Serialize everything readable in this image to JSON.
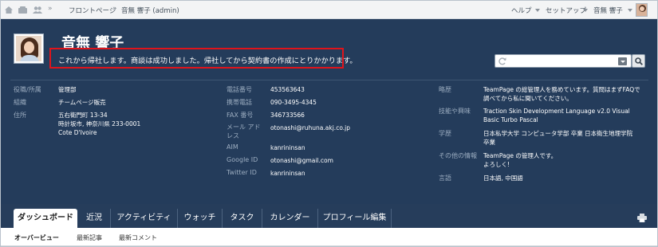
{
  "topbar": {
    "breadcrumb_home": "フロントページ",
    "breadcrumb_sep": "»",
    "breadcrumb_current": "音無 響子 (admin)",
    "help": "ヘルプ",
    "setup": "セットアップ",
    "user": "音無 響子"
  },
  "profile": {
    "name": "音無 響子",
    "status": "これから帰社します。商談は成功しました。帰社してから契約書の作成にとりかかります。"
  },
  "search": {
    "placeholder": ""
  },
  "fields_col1": [
    {
      "label": "役職/所属",
      "value": "管理部"
    },
    {
      "label": "組織",
      "value": "チームページ販売"
    },
    {
      "label": "住所",
      "value_lines": [
        "五右衛門町 13-34",
        "時計坂市, 神奈川県 233-0001",
        "Cote D'Ivoire"
      ]
    }
  ],
  "fields_col2": [
    {
      "label": "電話番号",
      "value": "453563643"
    },
    {
      "label": "携帯電話",
      "value": "090-3495-4345"
    },
    {
      "label": "FAX 番号",
      "value": "346733566"
    },
    {
      "label": "メール アドレス",
      "value": "otonashi@ruhuna.akj.co.jp"
    },
    {
      "label": "AIM",
      "value": "kanrininsan"
    },
    {
      "label": "Google ID",
      "value": "otonashi@gmail.com"
    },
    {
      "label": "Twitter ID",
      "value": "kanrininsan"
    }
  ],
  "fields_col3": [
    {
      "label": "略歴",
      "value_lines": [
        "TeamPage の総管理人を務めています。質問はまずFAQで",
        "調べてから私に聞いてください。"
      ]
    },
    {
      "label": "技能や興味",
      "value_lines": [
        "Traction Skin Development Language v2.0 Visual",
        "Basic Turbo Pascal"
      ]
    },
    {
      "label": "学歴",
      "value_lines": [
        "日本私学大学 コンピュータ学部 卒業 日本衛生地理学院",
        "卒業"
      ]
    },
    {
      "label": "その他の情報",
      "value_lines": [
        "TeamPage の管理人です。",
        "よろしく!"
      ]
    },
    {
      "label": "言語",
      "value": "日本語, 中国語"
    }
  ],
  "tabs": [
    "ダッシュボード",
    "近況",
    "アクティビティ",
    "ウォッチ",
    "タスク",
    "カレンダー",
    "プロフィール編集"
  ],
  "subnav": [
    "オーバービュー",
    "最新記事",
    "最新コメント"
  ],
  "colors": {
    "panel": "#243c5b",
    "highlight": "#e0141b",
    "label": "#9cadc0"
  },
  "icons": [
    "home-icon",
    "group-icon",
    "people-icon",
    "refresh-icon",
    "dropdown-icon",
    "search-icon",
    "print-icon",
    "avatar"
  ]
}
